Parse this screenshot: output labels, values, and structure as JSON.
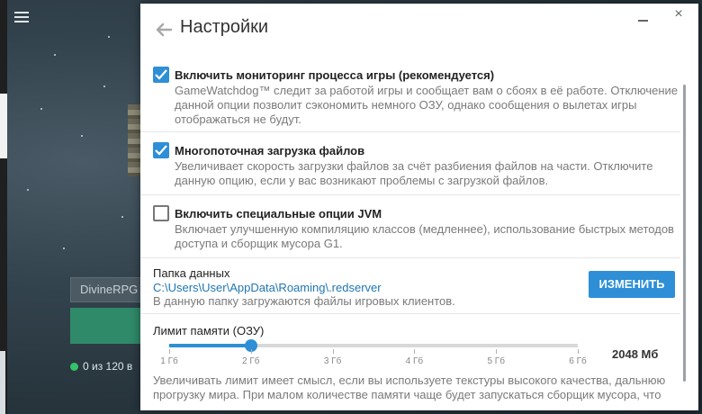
{
  "launcher": {
    "server_field_value": "DivineRPG",
    "status_text": "0 из 120 в",
    "status_color": "#35c46a"
  },
  "dialog": {
    "title": "Настройки",
    "back_icon": "arrow-left-icon",
    "minimize_icon": "minimize-icon",
    "close_icon": "close-icon",
    "close_glyph": "×"
  },
  "options": [
    {
      "checked": true,
      "title": "Включить мониторинг процесса игры (рекомендуется)",
      "description": "GameWatchdog™ следит за работой игры и сообщает вам о сбоях в её работе. Отключение данной опции позволит сэкономить немного ОЗУ, однако сообщения о вылетах игры отображаться не будут."
    },
    {
      "checked": true,
      "title": "Многопоточная загрузка файлов",
      "description": "Увеличивает скорость загрузки файлов за счёт разбиения файлов на части. Отключите данную опцию, если у вас возникают проблемы с загрузкой файлов."
    },
    {
      "checked": false,
      "title": "Включить специальные опции JVM",
      "description": "Включает улучшенную компиляцию классов (медленнее), использование быстрых методов доступа и сборщик мусора G1."
    }
  ],
  "data_folder": {
    "label": "Папка данных",
    "path": "C:\\Users\\User\\AppData\\Roaming\\.redserver",
    "description": "В данную папку загружаются файлы игровых клиентов.",
    "change_button": "ИЗМЕНИТЬ"
  },
  "memory": {
    "label": "Лимит памяти (ОЗУ)",
    "value_text": "2048 Мб",
    "value_gb": 2,
    "min_gb": 1,
    "max_gb": 6,
    "ticks": [
      "1 Гб",
      "2 Гб",
      "3 Гб",
      "4 Гб",
      "5 Гб",
      "6 Гб"
    ],
    "description": "Увеличивать лимит имеет смысл, если вы используете текстуры высокого качества, дальнюю прогрузку мира. При малом количестве памяти чаще будет запускаться сборщик мусора, что"
  },
  "colors": {
    "accent": "#2e8fd6",
    "link": "#1f76b5"
  }
}
